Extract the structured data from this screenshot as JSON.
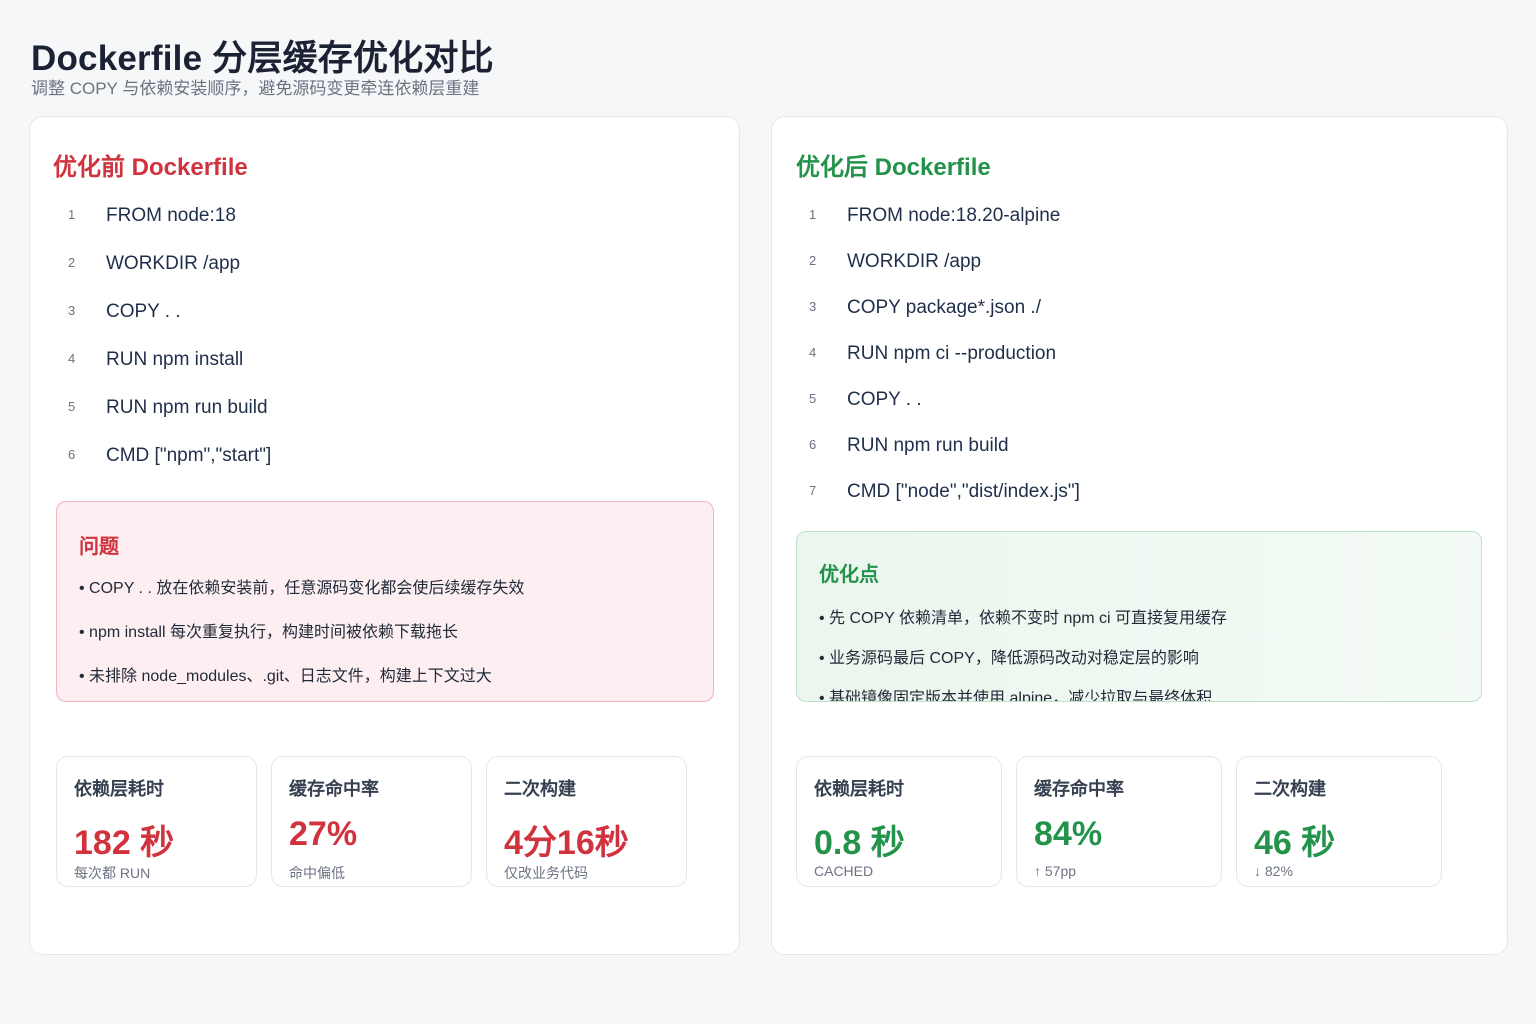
{
  "header": {
    "title": "Dockerfile 分层缓存优化对比",
    "subtitle": "调整 COPY 与依赖安装顺序，避免源码变更牵连依赖层重建"
  },
  "before": {
    "heading": "优化前 Dockerfile",
    "lines": [
      {
        "num": "1",
        "text": "FROM node:18"
      },
      {
        "num": "2",
        "text": "WORKDIR /app"
      },
      {
        "num": "3",
        "text": "COPY . ."
      },
      {
        "num": "4",
        "text": "RUN npm install"
      },
      {
        "num": "5",
        "text": "RUN npm run build"
      },
      {
        "num": "6",
        "text": "CMD [\"npm\",\"start\"]"
      }
    ],
    "problem": {
      "title": "问题",
      "items": [
        "• COPY . . 放在依赖安装前，任意源码变化都会使后续缓存失效",
        "• npm install 每次重复执行，构建时间被依赖下载拖长",
        "• 未排除 node_modules、.git、日志文件，构建上下文过大"
      ]
    },
    "stats": [
      {
        "label": "依赖层耗时",
        "value": "182 秒",
        "note": "每次都 RUN"
      },
      {
        "label": "缓存命中率",
        "value": "27%",
        "note": "命中偏低"
      },
      {
        "label": "二次构建",
        "value": "4分16秒",
        "note": "仅改业务代码"
      }
    ]
  },
  "after": {
    "heading": "优化后 Dockerfile",
    "lines": [
      {
        "num": "1",
        "text": "FROM node:18.20-alpine"
      },
      {
        "num": "2",
        "text": "WORKDIR /app"
      },
      {
        "num": "3",
        "text": "COPY package*.json ./"
      },
      {
        "num": "4",
        "text": "RUN npm ci --production"
      },
      {
        "num": "5",
        "text": "COPY . ."
      },
      {
        "num": "6",
        "text": "RUN npm run build"
      },
      {
        "num": "7",
        "text": "CMD [\"node\",\"dist/index.js\"]"
      }
    ],
    "optim": {
      "title": "优化点",
      "items": [
        "• 先 COPY 依赖清单，依赖不变时 npm ci 可直接复用缓存",
        "• 业务源码最后 COPY，降低源码改动对稳定层的影响",
        "• 基础镜像固定版本并使用 alpine，减少拉取与最终体积"
      ]
    },
    "stats": [
      {
        "label": "依赖层耗时",
        "value": "0.8 秒",
        "note": "CACHED"
      },
      {
        "label": "缓存命中率",
        "value": "84%",
        "note": "↑ 57pp"
      },
      {
        "label": "二次构建",
        "value": "46 秒",
        "note": "↓ 82%"
      }
    ]
  }
}
